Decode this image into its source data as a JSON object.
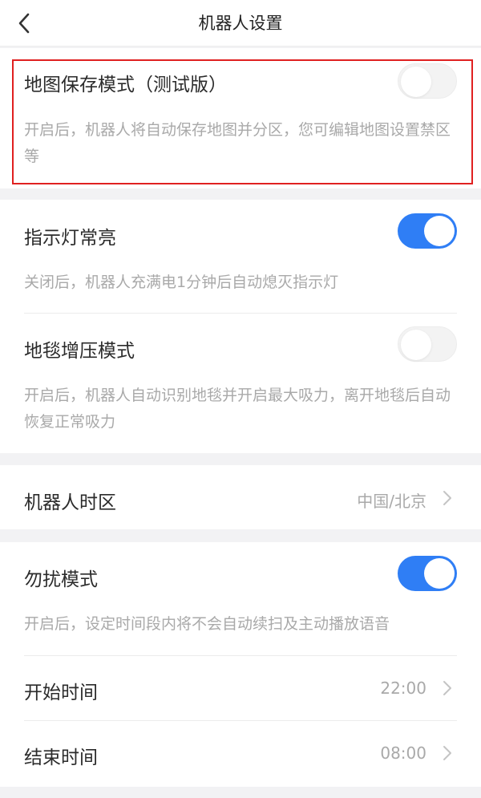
{
  "header": {
    "title": "机器人设置",
    "back_icon": "chevron-left-icon"
  },
  "map_save": {
    "title": "地图保存模式（测试版）",
    "desc": "开启后，机器人将自动保存地图并分区，您可编辑地图设置禁区等",
    "enabled": false
  },
  "indicator_light": {
    "title": "指示灯常亮",
    "desc": "关闭后，机器人充满电1分钟后自动熄灭指示灯",
    "enabled": true
  },
  "carpet_boost": {
    "title": "地毯增压模式",
    "desc": "开启后，机器人自动识别地毯并开启最大吸力，离开地毯后自动恢复正常吸力",
    "enabled": false
  },
  "timezone": {
    "title": "机器人时区",
    "value": "中国/北京"
  },
  "dnd": {
    "title": "勿扰模式",
    "desc": "开启后，设定时间段内将不会自动续扫及主动播放语音",
    "enabled": true,
    "start_label": "开始时间",
    "start_value": "22:00",
    "end_label": "结束时间",
    "end_value": "08:00"
  },
  "colors": {
    "accent": "#2f7ef5",
    "highlight": "#e02020",
    "background": "#f2f2f4"
  }
}
